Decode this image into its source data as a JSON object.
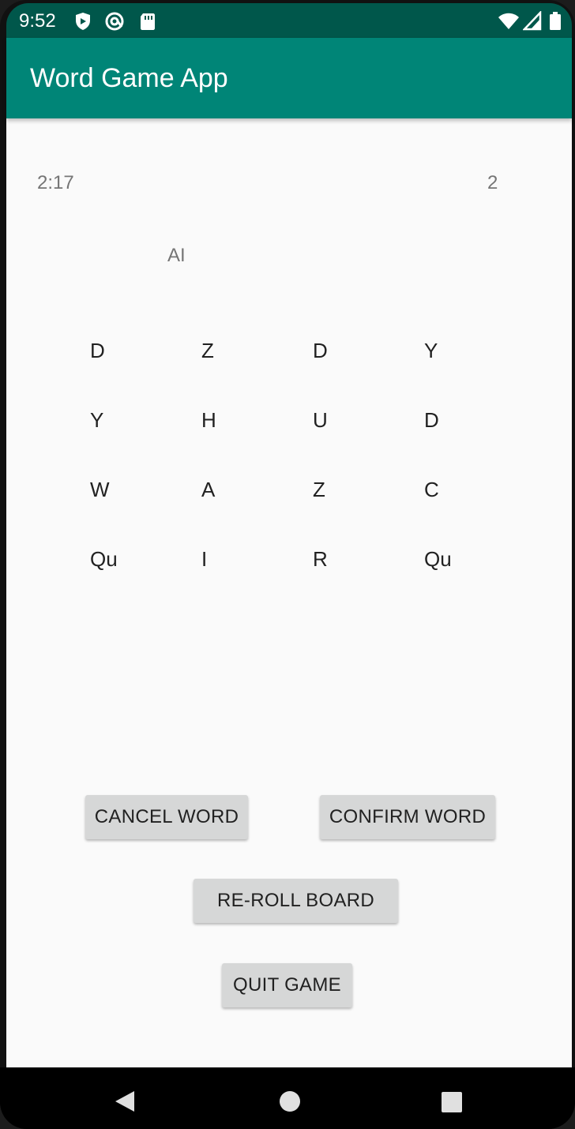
{
  "status_bar": {
    "time": "9:52",
    "icons": [
      "shield-icon",
      "at-sign-icon",
      "sd-card-icon",
      "wifi-icon",
      "signal-icon",
      "battery-icon"
    ]
  },
  "app_bar": {
    "title": "Word Game App",
    "color": "#008577"
  },
  "game": {
    "timer": "2:17",
    "score": "2",
    "current_word": "AI",
    "board": [
      [
        "D",
        "Z",
        "D",
        "Y"
      ],
      [
        "Y",
        "H",
        "U",
        "D"
      ],
      [
        "W",
        "A",
        "Z",
        "C"
      ],
      [
        "Qu",
        "I",
        "R",
        "Qu"
      ]
    ]
  },
  "buttons": {
    "cancel_word": "CANCEL WORD",
    "confirm_word": "CONFIRM WORD",
    "reroll_board": "RE-ROLL BOARD",
    "quit_game": "QUIT GAME"
  },
  "nav_bar": {
    "icons": [
      "back-icon",
      "home-icon",
      "recents-icon"
    ]
  }
}
